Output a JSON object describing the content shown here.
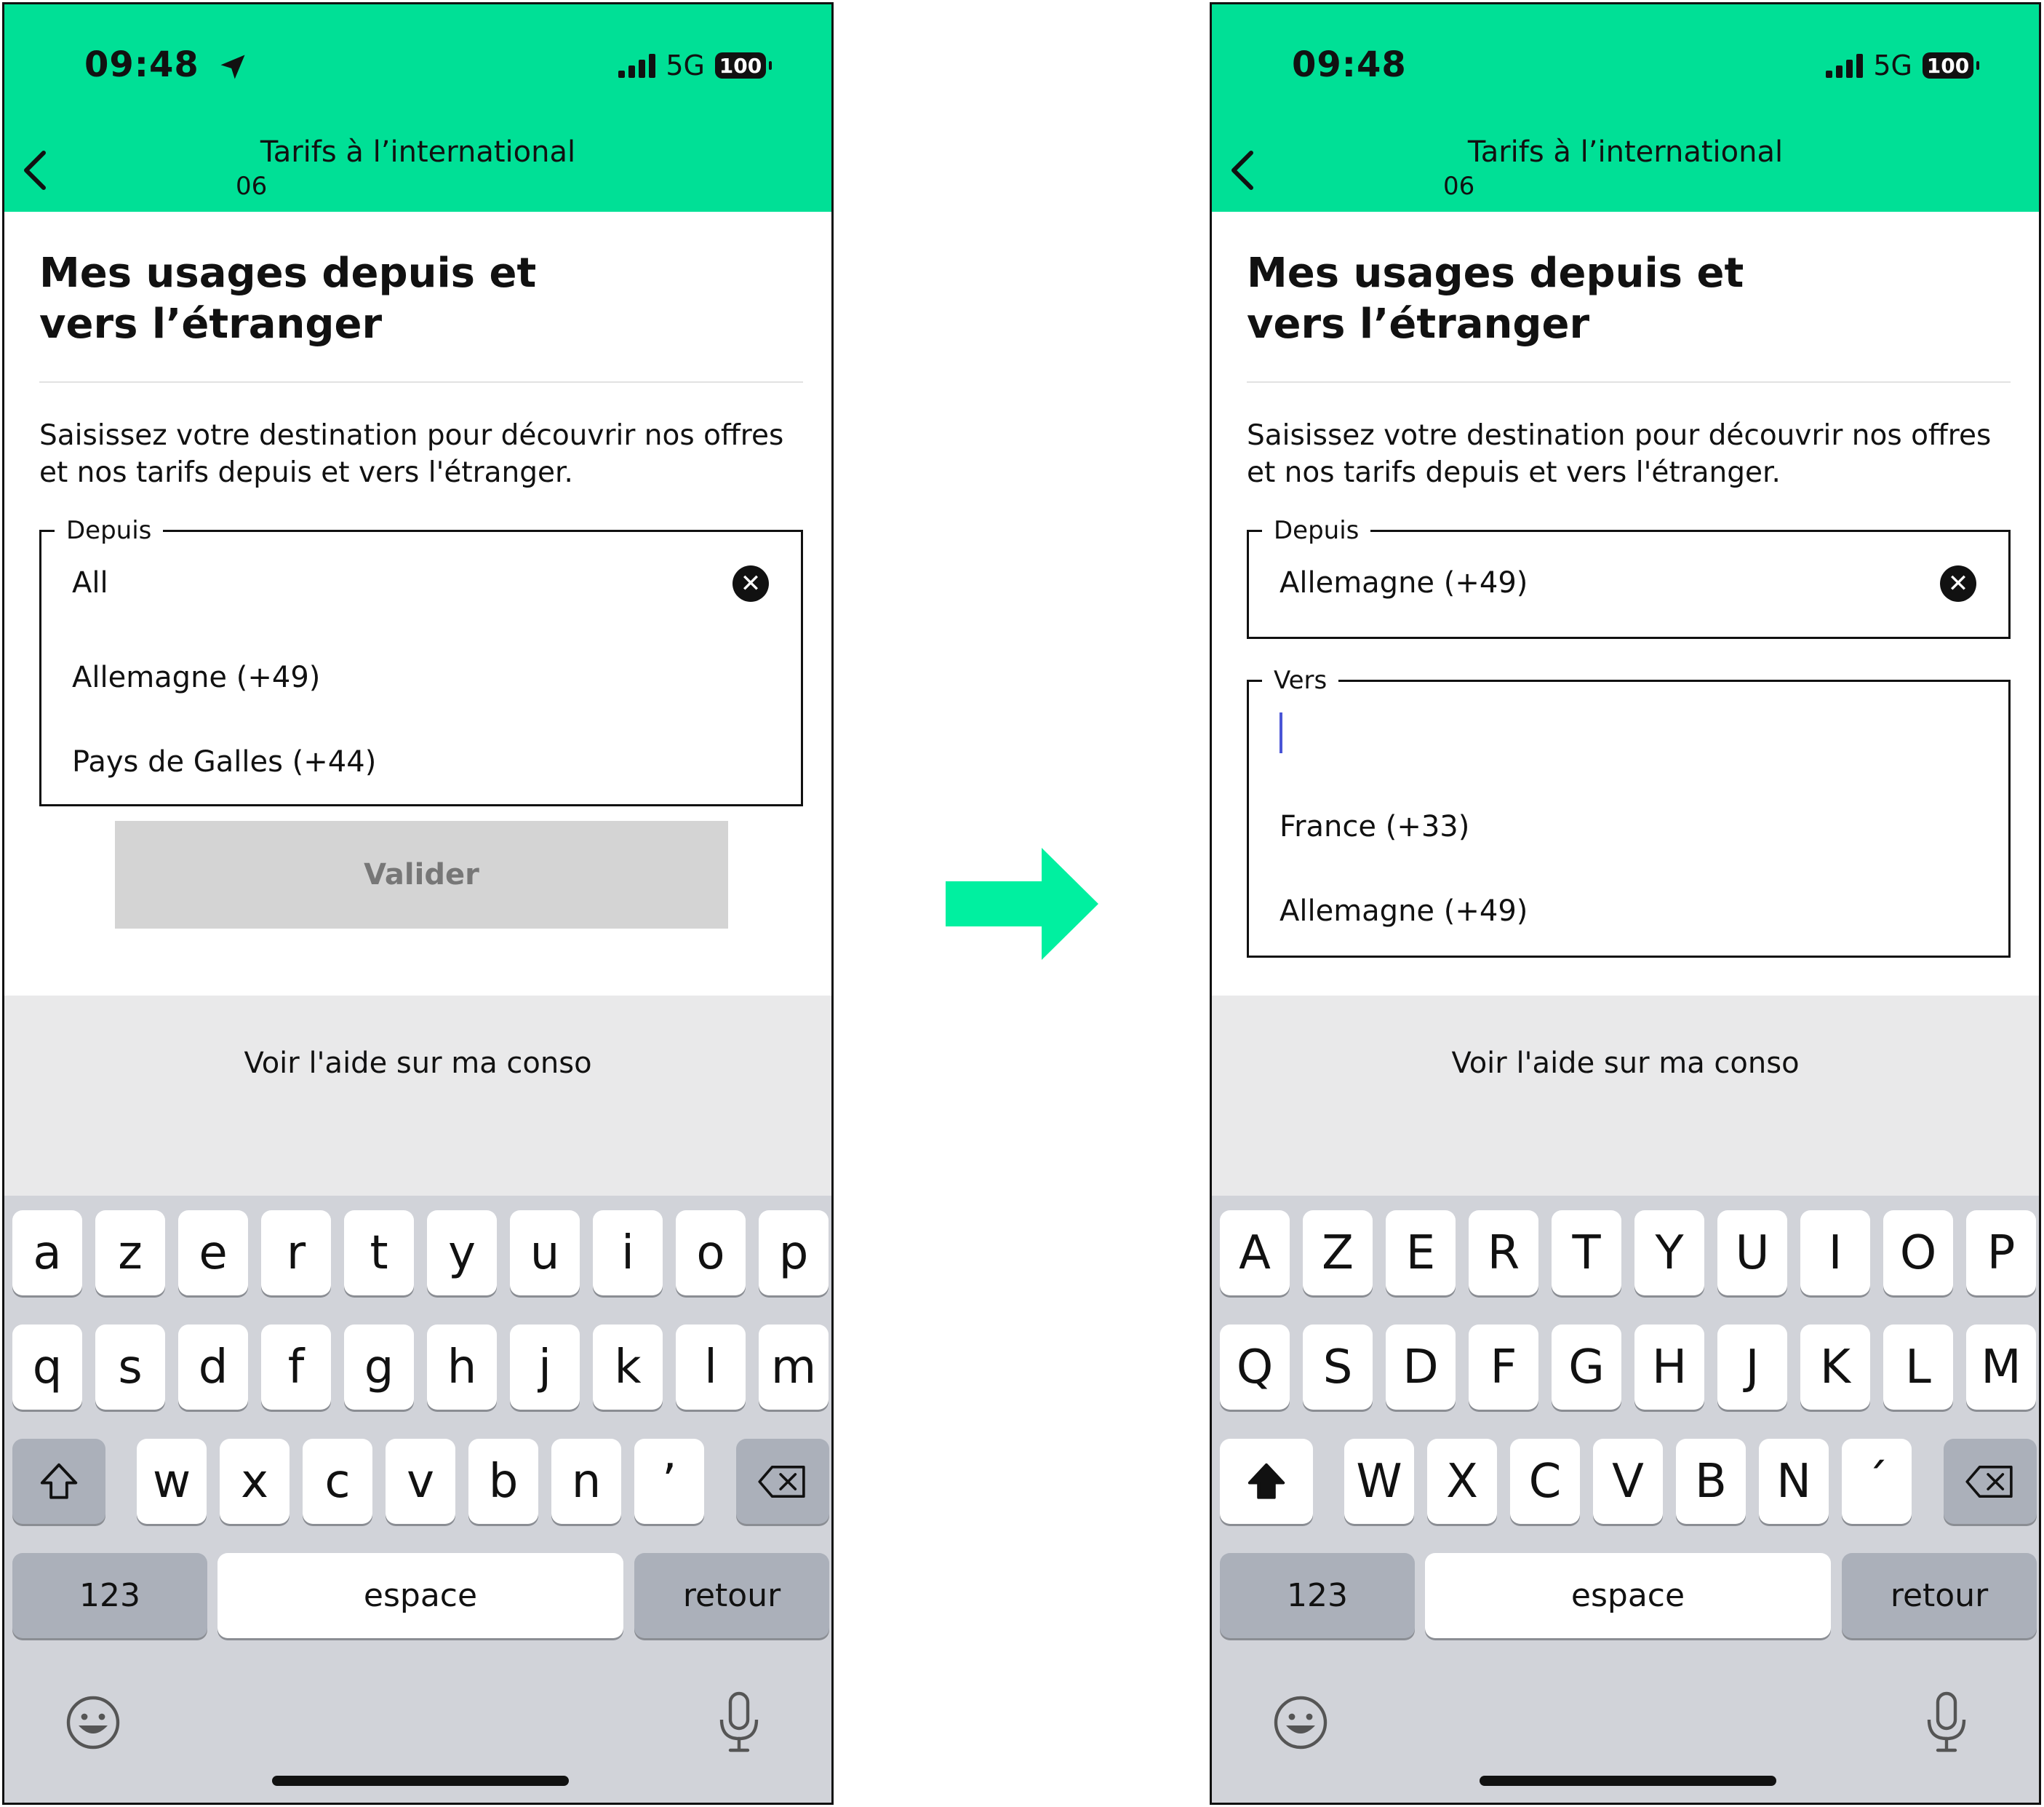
{
  "colors": {
    "header_green": "#00e096",
    "arrow_green": "#00f0a0",
    "caret": "#4a55d6"
  },
  "left": {
    "status": {
      "time": "09:48",
      "network": "5G",
      "battery": "100"
    },
    "header": {
      "title": "Tarifs à l’international",
      "subtitle": "06"
    },
    "page_title_line1": "Mes usages depuis et",
    "page_title_line2": "vers l’étranger",
    "intro": "Saisissez votre destination pour découvrir nos offres et nos tarifs depuis et vers l'étranger.",
    "depuis": {
      "legend": "Depuis",
      "value": "All",
      "options": [
        "Allemagne (+49)",
        "Pays de Galles (+44)"
      ]
    },
    "valider": "Valider",
    "help": "Voir l'aide sur ma conso",
    "keyboard": {
      "row1": [
        "a",
        "z",
        "e",
        "r",
        "t",
        "y",
        "u",
        "i",
        "o",
        "p"
      ],
      "row2": [
        "q",
        "s",
        "d",
        "f",
        "g",
        "h",
        "j",
        "k",
        "l",
        "m"
      ],
      "row3": [
        "w",
        "x",
        "c",
        "v",
        "b",
        "n",
        "’"
      ],
      "numbers": "123",
      "space": "espace",
      "return": "retour"
    }
  },
  "right": {
    "status": {
      "time": "09:48",
      "network": "5G",
      "battery": "100"
    },
    "header": {
      "title": "Tarifs à l’international",
      "subtitle": "06"
    },
    "page_title_line1": "Mes usages depuis et",
    "page_title_line2": "vers l’étranger",
    "intro": "Saisissez votre destination pour découvrir nos offres et nos tarifs depuis et vers l'étranger.",
    "depuis": {
      "legend": "Depuis",
      "value": "Allemagne (+49)"
    },
    "vers": {
      "legend": "Vers",
      "value": "",
      "options": [
        "France (+33)",
        "Allemagne (+49)"
      ]
    },
    "help": "Voir l'aide sur ma conso",
    "keyboard": {
      "row1": [
        "A",
        "Z",
        "E",
        "R",
        "T",
        "Y",
        "U",
        "I",
        "O",
        "P"
      ],
      "row2": [
        "Q",
        "S",
        "D",
        "F",
        "G",
        "H",
        "J",
        "K",
        "L",
        "M"
      ],
      "row3": [
        "W",
        "X",
        "C",
        "V",
        "B",
        "N",
        "´"
      ],
      "numbers": "123",
      "space": "espace",
      "return": "retour"
    }
  }
}
